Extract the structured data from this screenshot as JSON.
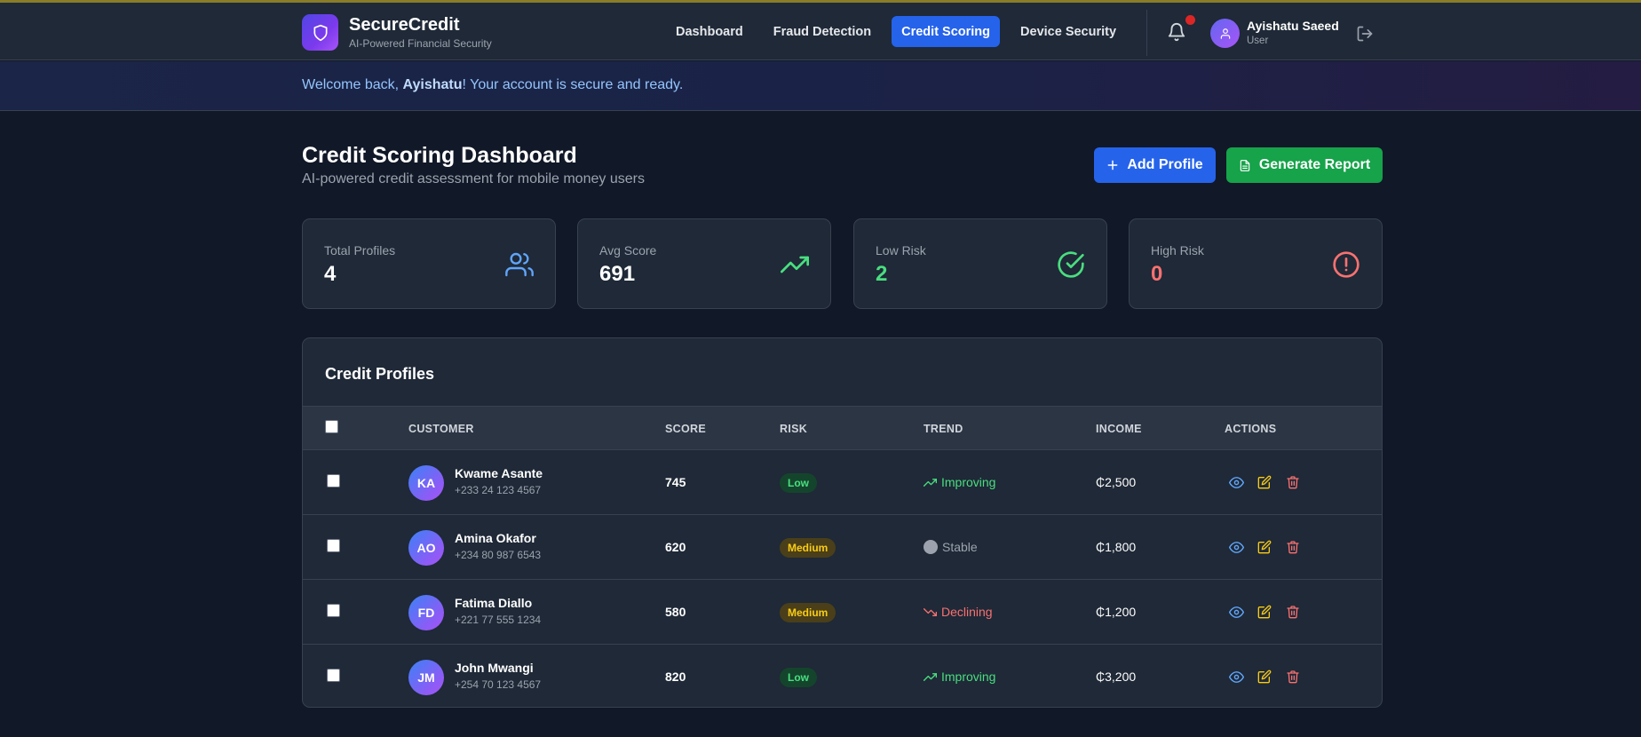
{
  "app": {
    "name": "SecureCredit",
    "tagline": "AI-Powered Financial Security",
    "logo_icon": "shield-icon"
  },
  "nav": {
    "items": [
      {
        "label": "Dashboard",
        "active": false
      },
      {
        "label": "Fraud Detection",
        "active": false
      },
      {
        "label": "Credit Scoring",
        "active": true
      },
      {
        "label": "Device Security",
        "active": false
      }
    ],
    "bell_icon": "bell-icon",
    "has_notification": true,
    "logout_icon": "logout-icon"
  },
  "user": {
    "name": "Ayishatu Saeed",
    "role": "User"
  },
  "welcome": {
    "prefix": "Welcome back, ",
    "name": "Ayishatu",
    "suffix": "! Your account is secure and ready."
  },
  "page": {
    "title": "Credit Scoring Dashboard",
    "subtitle": "AI-powered credit assessment for mobile money users",
    "add_button": "Add Profile",
    "report_button": "Generate Report"
  },
  "stats": [
    {
      "label": "Total Profiles",
      "value": "4",
      "icon": "users-icon",
      "color": "#ffffff",
      "icon_color": "#60a5fa"
    },
    {
      "label": "Avg Score",
      "value": "691",
      "icon": "trending-up-icon",
      "color": "#ffffff",
      "icon_color": "#4ade80"
    },
    {
      "label": "Low Risk",
      "value": "2",
      "icon": "check-circle-icon",
      "color": "#4ade80",
      "icon_color": "#4ade80"
    },
    {
      "label": "High Risk",
      "value": "0",
      "icon": "alert-circle-icon",
      "color": "#f87171",
      "icon_color": "#f87171"
    }
  ],
  "table": {
    "title": "Credit Profiles",
    "columns": [
      "CUSTOMER",
      "SCORE",
      "RISK",
      "TREND",
      "INCOME",
      "ACTIONS"
    ],
    "rows": [
      {
        "initials": "KA",
        "name": "Kwame Asante",
        "phone": "+233 24 123 4567",
        "score": "745",
        "risk": "Low",
        "trend": "Improving",
        "income": "₵2,500"
      },
      {
        "initials": "AO",
        "name": "Amina Okafor",
        "phone": "+234 80 987 6543",
        "score": "620",
        "risk": "Medium",
        "trend": "Stable",
        "income": "₵1,800"
      },
      {
        "initials": "FD",
        "name": "Fatima Diallo",
        "phone": "+221 77 555 1234",
        "score": "580",
        "risk": "Medium",
        "trend": "Declining",
        "income": "₵1,200"
      },
      {
        "initials": "JM",
        "name": "John Mwangi",
        "phone": "+254 70 123 4567",
        "score": "820",
        "risk": "Low",
        "trend": "Improving",
        "income": "₵3,200"
      }
    ]
  },
  "colors": {
    "accent": "#2563eb",
    "success": "#16a34a",
    "danger": "#dc2626"
  }
}
